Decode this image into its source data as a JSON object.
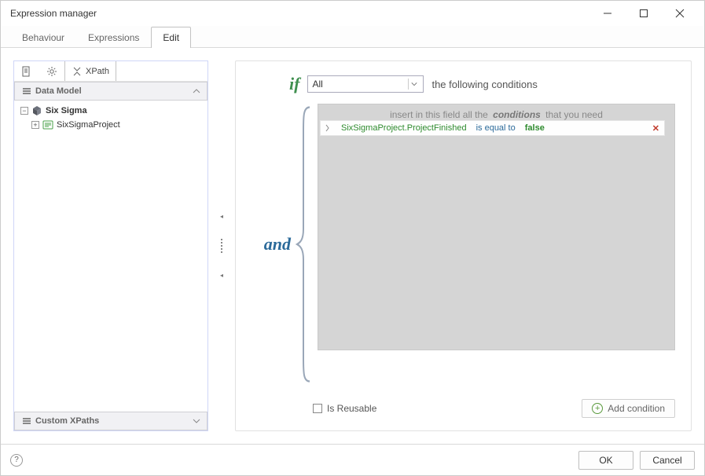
{
  "window": {
    "title": "Expression manager"
  },
  "tabs": {
    "items": [
      "Behaviour",
      "Expressions",
      "Edit"
    ],
    "active": 2
  },
  "left": {
    "xpath_label": "XPath",
    "section_data_model": "Data Model",
    "section_custom": "Custom XPaths",
    "tree": {
      "root": {
        "label": "Six Sigma",
        "expanded": true
      },
      "child": {
        "label": "SixSigmaProject",
        "expanded": false
      }
    }
  },
  "editor": {
    "kw_if": "if",
    "scope_select": {
      "value": "All"
    },
    "following_text": "the following conditions",
    "kw_and": "and",
    "hint": {
      "pre": "insert in this field all the",
      "mid": "conditions",
      "post": "that you need"
    },
    "conditions": [
      {
        "expr": "SixSigmaProject.ProjectFinished",
        "op": "is equal to",
        "val": "false"
      }
    ],
    "reusable_label": "Is Reusable",
    "add_condition_label": "Add condition"
  },
  "footer": {
    "ok": "OK",
    "cancel": "Cancel"
  }
}
